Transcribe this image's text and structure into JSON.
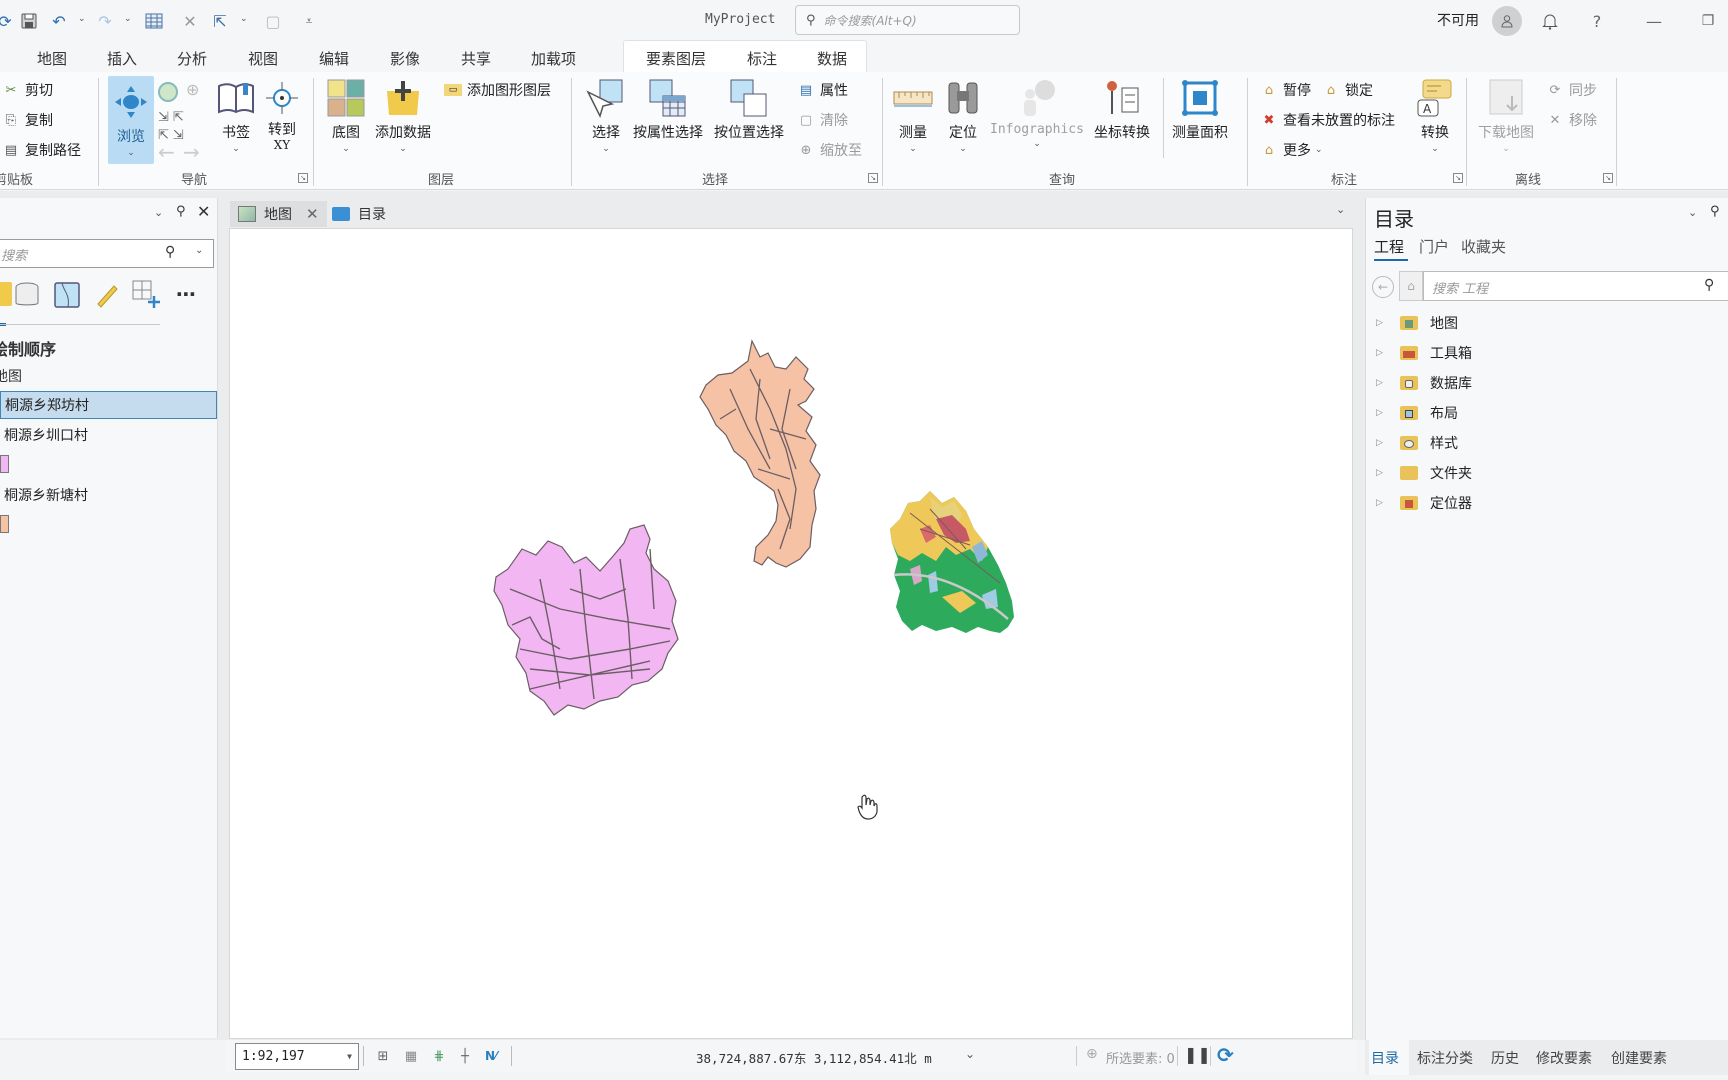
{
  "app": {
    "project_name": "MyProject",
    "command_search_placeholder": "命令搜索(Alt+Q)",
    "user_status": "不可用"
  },
  "ribbon_tabs": [
    {
      "label": "地图",
      "active": true
    },
    {
      "label": "插入"
    },
    {
      "label": "分析"
    },
    {
      "label": "视图"
    },
    {
      "label": "编辑"
    },
    {
      "label": "影像"
    },
    {
      "label": "共享"
    },
    {
      "label": "加载项"
    }
  ],
  "contextual_tabs": [
    "要素图层",
    "标注",
    "数据"
  ],
  "ribbon": {
    "clipboard": {
      "label": "剪贴板",
      "cut": "剪切",
      "copy": "复制",
      "copy_path": "复制路径"
    },
    "navigate": {
      "label": "导航",
      "explore": "浏览",
      "bookmarks": "书签",
      "goto_xy_line1": "转到",
      "goto_xy_line2": "XY"
    },
    "layer": {
      "label": "图层",
      "basemap": "底图",
      "add_data": "添加数据",
      "add_graphics_layer": "添加图形图层"
    },
    "selection": {
      "label": "选择",
      "select": "选择",
      "select_by_attributes": "按属性选择",
      "select_by_location": "按位置选择",
      "attributes": "属性",
      "clear": "清除",
      "zoom_to": "缩放至"
    },
    "inquiry": {
      "label": "查询",
      "measure": "测量",
      "locate": "定位",
      "infographics": "Infographics",
      "coordinate_conversion": "坐标转换",
      "measure_area": "测量面积"
    },
    "labeling": {
      "label": "标注",
      "pause": "暂停",
      "lock": "锁定",
      "view_unplaced": "查看未放置的标注",
      "more": "更多",
      "convert": "转换"
    },
    "offline": {
      "label": "离线",
      "download_map": "下载地图",
      "sync": "同步",
      "remove": "移除"
    }
  },
  "contents_pane": {
    "search_placeholder": "搜索",
    "drawing_order_label": "绘制顺序",
    "map_label": "地图",
    "layers": [
      {
        "name": "桐源乡郑坊村",
        "selected": true,
        "swatch": null
      },
      {
        "name": "桐源乡圳口村",
        "selected": false,
        "swatch": "#f2b6f2"
      },
      {
        "name": "桐源乡新塘村",
        "selected": false,
        "swatch": "#f6c2a6"
      }
    ]
  },
  "map_view": {
    "tabs": [
      {
        "label": "地图",
        "active": true,
        "closable": true
      },
      {
        "label": "目录",
        "active": false,
        "closable": false
      }
    ],
    "layer_colors": {
      "zhengfang": "#2eaa5c",
      "zhenkou": "#f2b6f2",
      "xintang": "#f6c2a6",
      "outline": "#6b5e63"
    }
  },
  "status_bar": {
    "scale": "1:92,197",
    "coordinates": "38,724,887.67东 3,112,854.41北 m",
    "selected_features": "所选要素: 0"
  },
  "catalog_pane": {
    "title": "目录",
    "tabs": [
      {
        "label": "工程",
        "active": true
      },
      {
        "label": "门户"
      },
      {
        "label": "收藏夹"
      }
    ],
    "search_placeholder": "搜索 工程",
    "items": [
      {
        "label": "地图",
        "icon": "map-folder-icon"
      },
      {
        "label": "工具箱",
        "icon": "toolbox-folder-icon"
      },
      {
        "label": "数据库",
        "icon": "database-folder-icon"
      },
      {
        "label": "布局",
        "icon": "layout-folder-icon"
      },
      {
        "label": "样式",
        "icon": "style-folder-icon"
      },
      {
        "label": "文件夹",
        "icon": "folder-icon"
      },
      {
        "label": "定位器",
        "icon": "locator-folder-icon"
      }
    ]
  },
  "bottom_tabs": [
    {
      "label": "目录",
      "active": true
    },
    {
      "label": "标注分类"
    },
    {
      "label": "历史"
    },
    {
      "label": "修改要素"
    },
    {
      "label": "创建要素"
    }
  ]
}
